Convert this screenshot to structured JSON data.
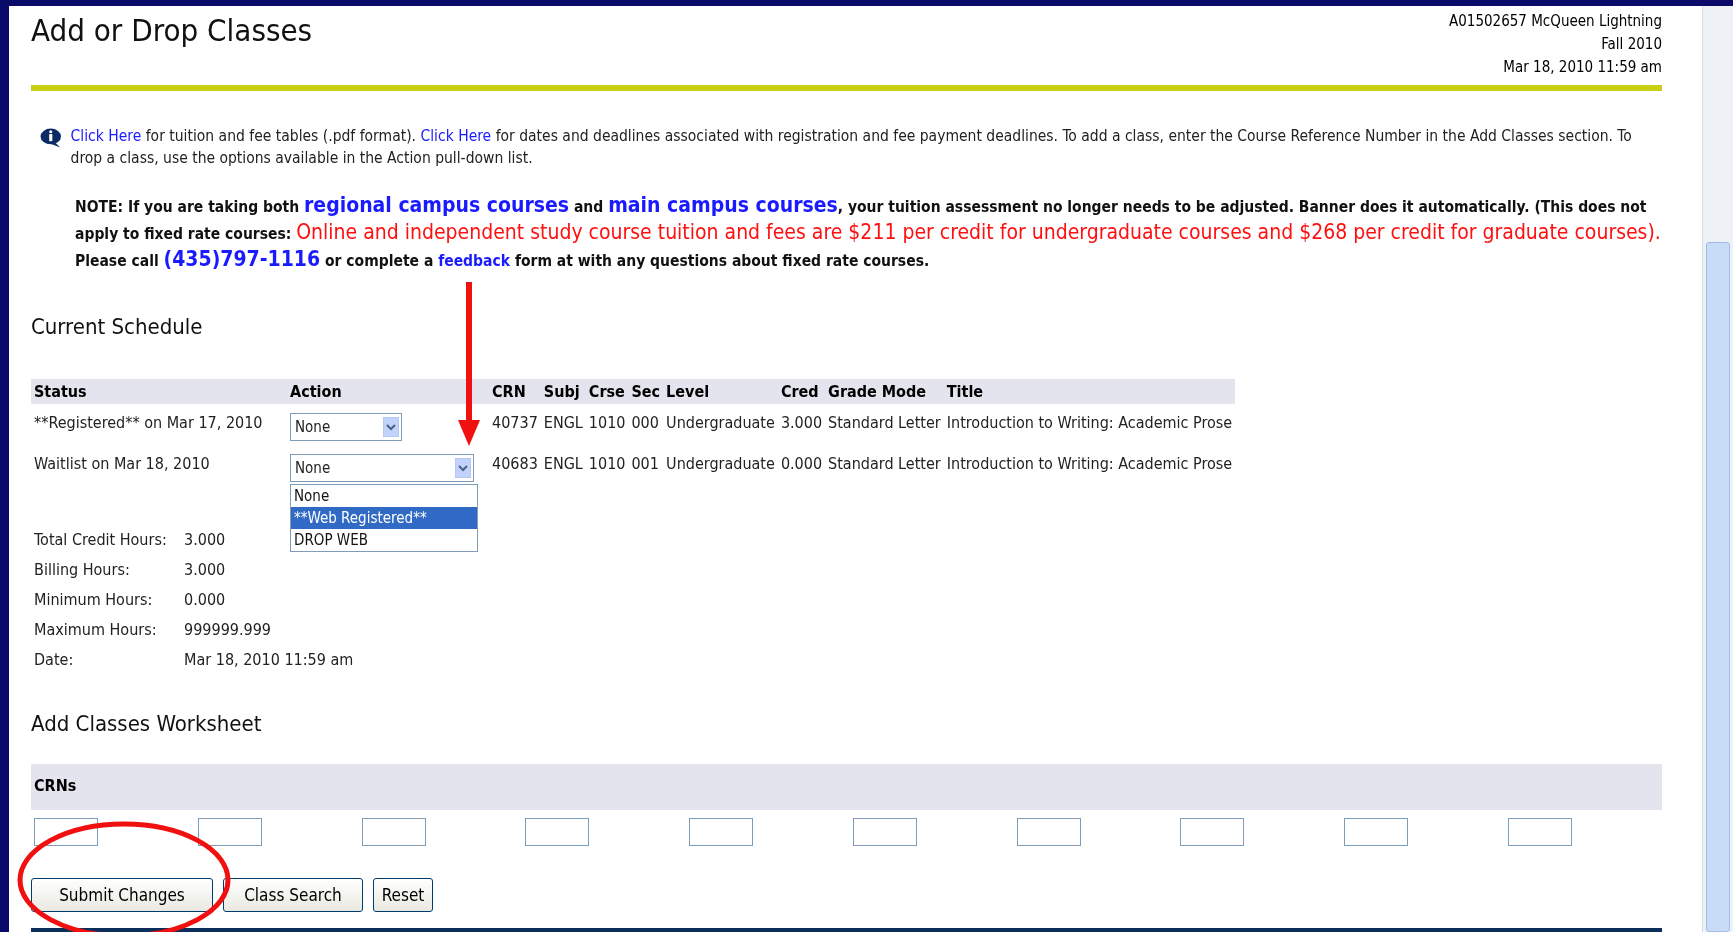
{
  "header": {
    "title": "Add or Drop Classes",
    "student": "A01502657 McQueen Lightning",
    "term": "Fall 2010",
    "timestamp": "Mar 18, 2010 11:59 am"
  },
  "info": [
    {
      "kind": "link",
      "text": "Click Here"
    },
    {
      "kind": "text",
      "text": " for tuition and fee tables (.pdf format). "
    },
    {
      "kind": "link",
      "text": "Click Here"
    },
    {
      "kind": "text",
      "text": " for dates and deadlines associated with registration and fee payment deadlines. To add a class, enter the Course Reference Number in the Add Classes section. To drop a class, use the options available in the Action pull-down list."
    }
  ],
  "note": [
    {
      "kind": "text",
      "text": "NOTE: If you are taking both "
    },
    {
      "kind": "biglink",
      "text": "regional campus courses"
    },
    {
      "kind": "text",
      "text": " and "
    },
    {
      "kind": "biglink",
      "text": "main campus courses"
    },
    {
      "kind": "text",
      "text": ", your tuition assessment no longer needs to be adjusted. Banner does it automatically. (This does not apply to fixed rate courses: "
    },
    {
      "kind": "alert",
      "text": "Online and independent study course tuition and fees are $211 per credit for undergraduate courses and $268 per credit for graduate courses)."
    },
    {
      "kind": "text",
      "text": " Please call "
    },
    {
      "kind": "biglink",
      "text": "(435)797-1116"
    },
    {
      "kind": "text",
      "text": " or complete a "
    },
    {
      "kind": "link",
      "text": "feedback"
    },
    {
      "kind": "text",
      "text": " form at with any questions about fixed rate courses."
    }
  ],
  "schedule": {
    "title": "Current Schedule",
    "columns": [
      "Status",
      "Action",
      "CRN",
      "Subj",
      "Crse",
      "Sec",
      "Level",
      "Cred",
      "Grade Mode",
      "Title"
    ],
    "rows": [
      {
        "status": "**Registered** on Mar 17, 2010",
        "action": "None",
        "expanded": false,
        "crn": "40737",
        "subj": "ENGL",
        "crse": "1010",
        "sec": "000",
        "level": "Undergraduate",
        "cred": "3.000",
        "grade_mode": "Standard Letter",
        "title": "Introduction to Writing: Academic Prose"
      },
      {
        "status": "Waitlist on Mar 18, 2010",
        "action": "None",
        "expanded": true,
        "options": [
          {
            "label": "None",
            "selected": false
          },
          {
            "label": "**Web Registered**",
            "selected": true
          },
          {
            "label": "DROP WEB",
            "selected": false
          }
        ],
        "crn": "40683",
        "subj": "ENGL",
        "crse": "1010",
        "sec": "001",
        "level": "Undergraduate",
        "cred": "0.000",
        "grade_mode": "Standard Letter",
        "title": "Introduction to Writing: Academic Prose"
      }
    ]
  },
  "totals": [
    {
      "label": "Total Credit Hours:",
      "value": "3.000"
    },
    {
      "label": "Billing Hours:",
      "value": "3.000"
    },
    {
      "label": "Minimum Hours:",
      "value": "0.000"
    },
    {
      "label": "Maximum Hours:",
      "value": "999999.999"
    },
    {
      "label": "Date:",
      "value": "Mar 18, 2010 11:59 am"
    }
  ],
  "worksheet": {
    "title": "Add Classes Worksheet",
    "header": "CRNs",
    "fields": [
      {
        "kind": "crn"
      },
      {
        "kind": "crn"
      },
      {
        "kind": "crn"
      },
      {
        "kind": "crn"
      },
      {
        "kind": "crn"
      },
      {
        "kind": "crn"
      },
      {
        "kind": "crn"
      },
      {
        "kind": "crn"
      },
      {
        "kind": "crn"
      },
      {
        "kind": "crn"
      }
    ]
  },
  "buttons": [
    {
      "label": "Submit Changes",
      "kind": "submit"
    },
    {
      "label": "Class Search",
      "kind": "search"
    },
    {
      "label": "Reset",
      "kind": "reset"
    }
  ]
}
